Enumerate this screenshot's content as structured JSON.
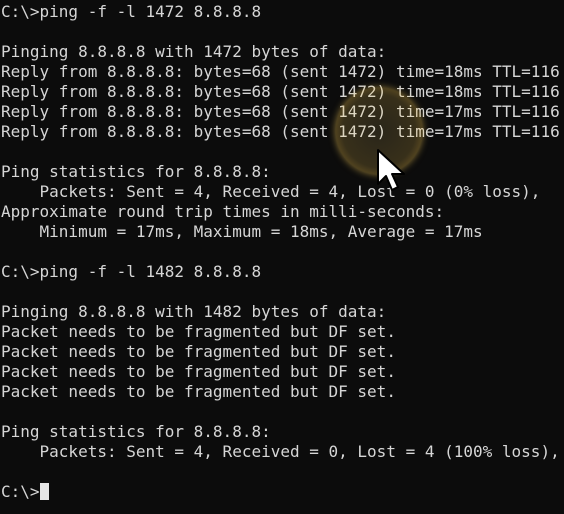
{
  "terminal": {
    "lines": [
      "C:\\>ping -f -l 1472 8.8.8.8",
      "",
      "Pinging 8.8.8.8 with 1472 bytes of data:",
      "Reply from 8.8.8.8: bytes=68 (sent 1472) time=18ms TTL=116",
      "Reply from 8.8.8.8: bytes=68 (sent 1472) time=18ms TTL=116",
      "Reply from 8.8.8.8: bytes=68 (sent 1472) time=17ms TTL=116",
      "Reply from 8.8.8.8: bytes=68 (sent 1472) time=17ms TTL=116",
      "",
      "Ping statistics for 8.8.8.8:",
      "    Packets: Sent = 4, Received = 4, Lost = 0 (0% loss),",
      "Approximate round trip times in milli-seconds:",
      "    Minimum = 17ms, Maximum = 18ms, Average = 17ms",
      "",
      "C:\\>ping -f -l 1482 8.8.8.8",
      "",
      "Pinging 8.8.8.8 with 1482 bytes of data:",
      "Packet needs to be fragmented but DF set.",
      "Packet needs to be fragmented but DF set.",
      "Packet needs to be fragmented but DF set.",
      "Packet needs to be fragmented but DF set.",
      "",
      "Ping statistics for 8.8.8.8:",
      "    Packets: Sent = 4, Received = 0, Lost = 4 (100% loss),",
      ""
    ],
    "prompt": "C:\\>",
    "colors": {
      "background": "#0c0c0c",
      "text": "#d6d6d6",
      "cursor": "#e6e6e6",
      "click_highlight": "#ffd25a"
    },
    "icons": {
      "mouse_pointer": "arrow-pointer-icon",
      "click_indicator": "click-highlight-icon"
    }
  }
}
